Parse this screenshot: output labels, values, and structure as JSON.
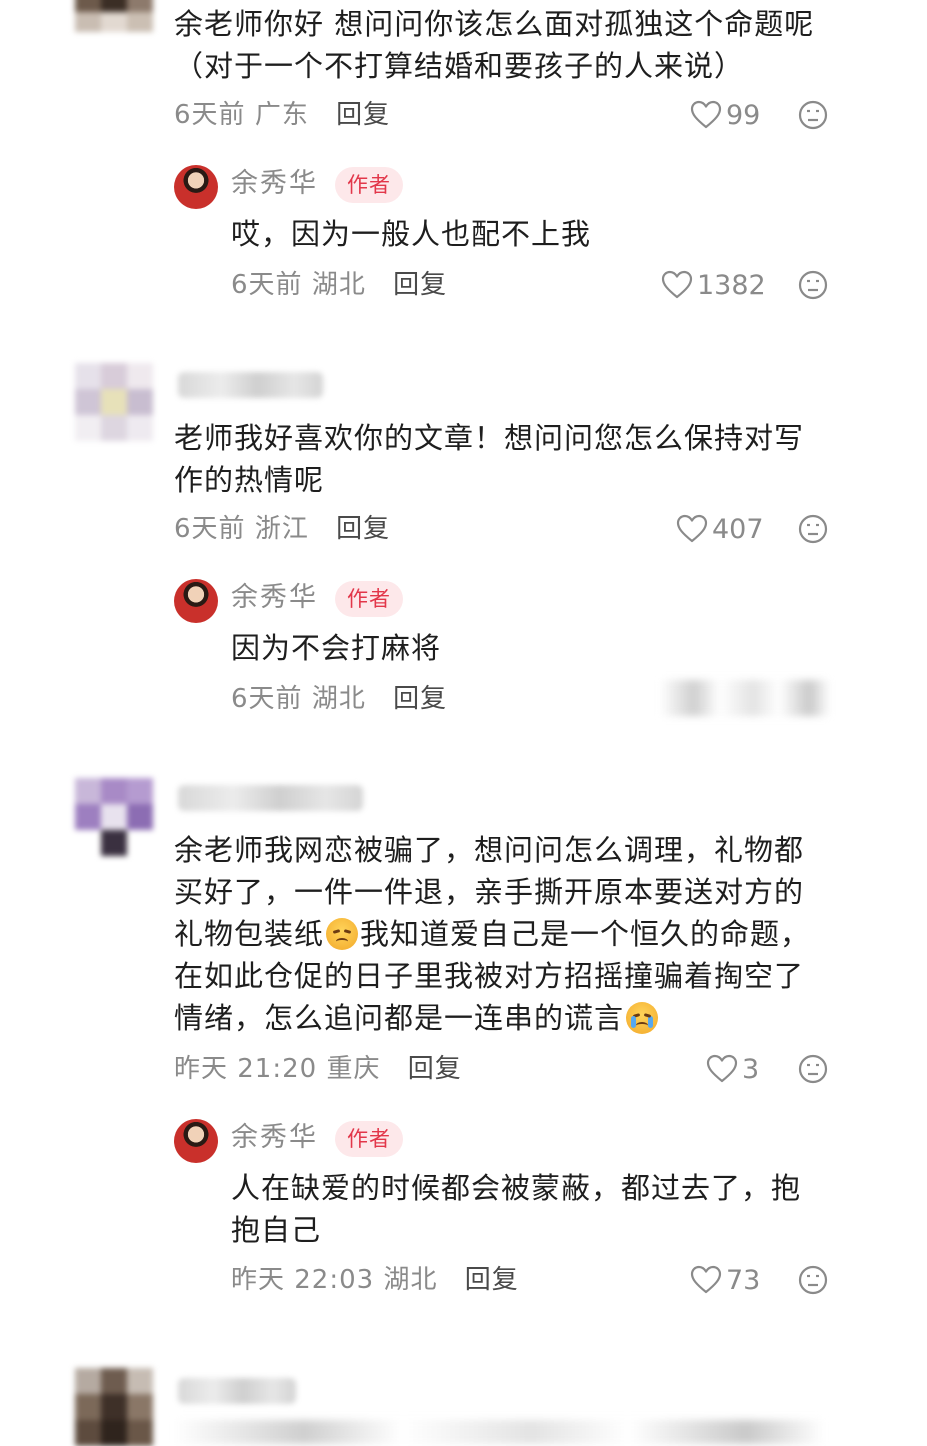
{
  "comments": [
    {
      "text_lines": [
        "余老师你好 想问问你该怎么面对孤独这个命题呢",
        "（对于一个不打算结婚和要孩子的人来说）"
      ],
      "time": "6天前",
      "location": "广东",
      "reply_label": "回复",
      "likes": "99",
      "author_reply": {
        "name": "余秀华",
        "badge": "作者",
        "text_lines": [
          "哎，因为一般人也配不上我"
        ],
        "time": "6天前",
        "location": "湖北",
        "reply_label": "回复",
        "likes": "1382"
      }
    },
    {
      "text_lines": [
        "老师我好喜欢你的文章！想问问您怎么保持对写",
        "作的热情呢"
      ],
      "time": "6天前",
      "location": "浙江",
      "reply_label": "回复",
      "likes": "407",
      "author_reply": {
        "name": "余秀华",
        "badge": "作者",
        "text_lines": [
          "因为不会打麻将"
        ],
        "time": "6天前",
        "location": "湖北",
        "reply_label": "回复"
      }
    },
    {
      "text_lines": [
        "余老师我网恋被骗了，想问问怎么调理，礼物都",
        "买好了，一件一件退，亲手撕开原本要送对方的",
        "礼物包装纸",
        "我知道爱自己是一个恒久的命题，",
        "在如此仓促的日子里我被对方招摇撞骗着掏空了",
        "情绪，怎么追问都是一连串的谎言"
      ],
      "emojis": [
        "sad-face-emoji",
        "crying-face-emoji"
      ],
      "time": "昨天 21:20",
      "location": "重庆",
      "reply_label": "回复",
      "likes": "3",
      "author_reply": {
        "name": "余秀华",
        "badge": "作者",
        "text_lines": [
          "人在缺爱的时候都会被蒙蔽，都过去了，抱",
          "抱自己"
        ],
        "time": "昨天 22:03",
        "location": "湖北",
        "reply_label": "回复",
        "likes": "73"
      }
    }
  ],
  "colors": {
    "badge_bg": "#fde8ea",
    "badge_text": "#e2374a",
    "meta": "#8a8a8a"
  }
}
